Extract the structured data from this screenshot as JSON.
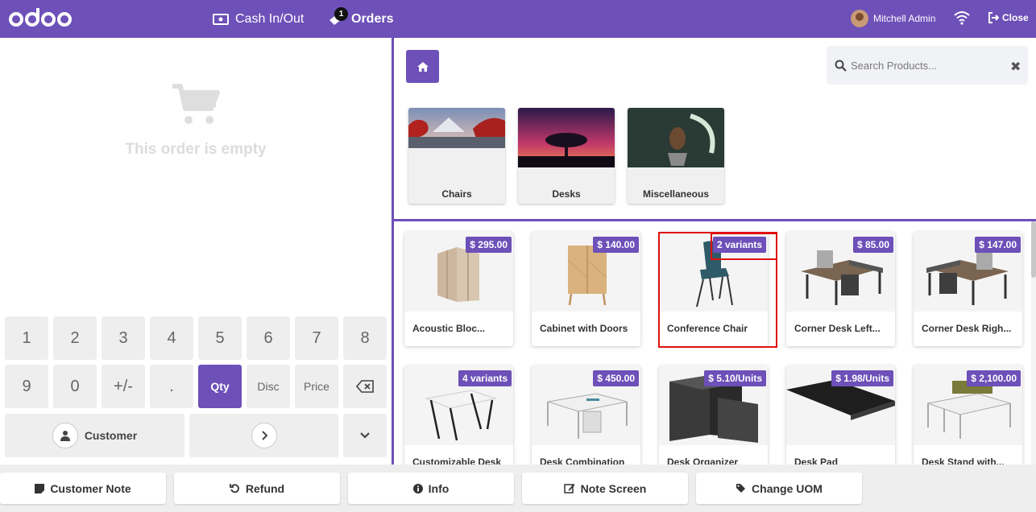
{
  "topbar": {
    "cash_label": "Cash In/Out",
    "orders_label": "Orders",
    "orders_badge": "1",
    "user_name": "Mitchell Admin",
    "close_label": "Close"
  },
  "order": {
    "empty_text": "This order is empty"
  },
  "numpad": {
    "keys": [
      "1",
      "2",
      "3",
      "4",
      "5",
      "6",
      "7",
      "8",
      "9",
      "0",
      "+/-",
      "."
    ],
    "qty_label": "Qty",
    "disc_label": "Disc",
    "price_label": "Price",
    "customer_label": "Customer"
  },
  "search": {
    "placeholder": "Search Products..."
  },
  "categories": [
    {
      "label": "Chairs"
    },
    {
      "label": "Desks"
    },
    {
      "label": "Miscellaneous"
    }
  ],
  "products": [
    {
      "name": "Acoustic Bloc...",
      "badge": "$ 295.00"
    },
    {
      "name": "Cabinet with Doors",
      "badge": "$ 140.00"
    },
    {
      "name": "Conference Chair",
      "badge": "2 variants"
    },
    {
      "name": "Corner Desk Left...",
      "badge": "$ 85.00"
    },
    {
      "name": "Corner Desk Righ...",
      "badge": "$ 147.00"
    },
    {
      "name": "Customizable Desk",
      "badge": "4 variants"
    },
    {
      "name": "Desk Combination",
      "badge": "$ 450.00"
    },
    {
      "name": "Desk Organizer",
      "badge": "$ 5.10/Units"
    },
    {
      "name": "Desk Pad",
      "badge": "$ 1.98/Units"
    },
    {
      "name": "Desk Stand with...",
      "badge": "$ 2,100.00"
    }
  ],
  "controls": {
    "customer_note": "Customer Note",
    "refund": "Refund",
    "info": "Info",
    "note_screen": "Note Screen",
    "change_uom": "Change UOM"
  },
  "colors": {
    "brand": "#6d50b8",
    "highlight": "#e01010"
  }
}
